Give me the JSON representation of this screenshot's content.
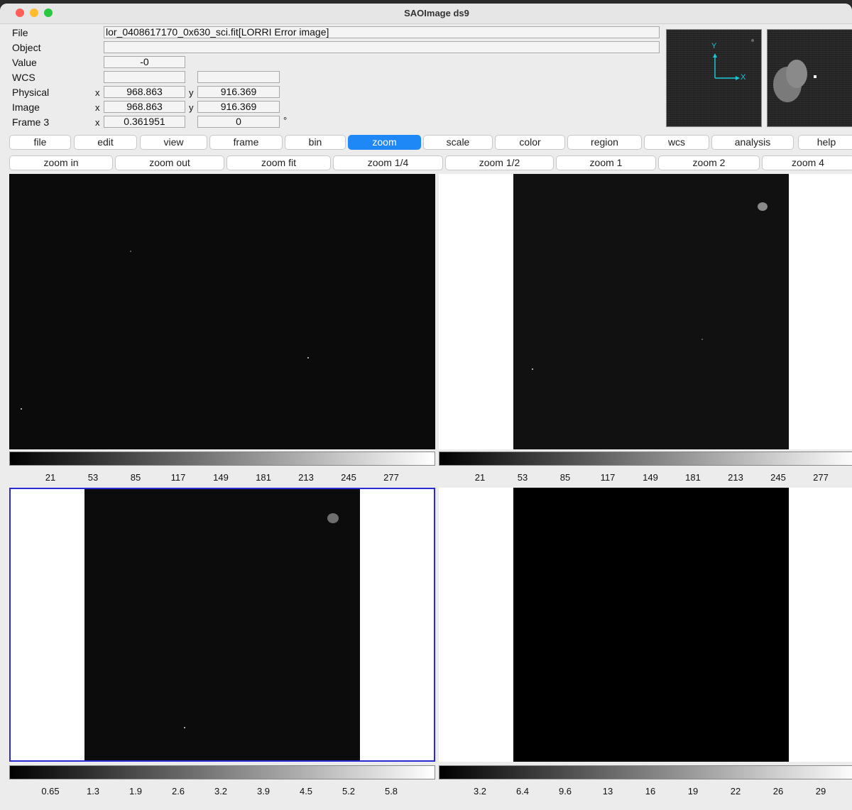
{
  "window": {
    "title": "SAOImage ds9"
  },
  "info": {
    "rows": [
      {
        "label": "File"
      },
      {
        "label": "Object"
      },
      {
        "label": "Value"
      },
      {
        "label": "WCS"
      },
      {
        "label": "Physical",
        "x_label": "x",
        "y_label": "y"
      },
      {
        "label": "Image",
        "x_label": "x",
        "y_label": "y"
      },
      {
        "label": "Frame 3",
        "x_label": "x"
      }
    ],
    "file": "lor_0408617170_0x630_sci.fit[LORRI Error image]",
    "object": "",
    "value": "-0",
    "wcs_a": "",
    "wcs_b": "",
    "physical_x": "968.863",
    "physical_y": "916.369",
    "image_x": "968.863",
    "image_y": "916.369",
    "frame_zoom": "0.361951",
    "frame_angle": "0",
    "degree_symbol": "°"
  },
  "panner": {
    "y_axis": "Y",
    "x_axis": "X",
    "axis_color": "#19c6d8"
  },
  "main_menu": [
    "file",
    "edit",
    "view",
    "frame",
    "bin",
    "zoom",
    "scale",
    "color",
    "region",
    "wcs",
    "analysis",
    "help"
  ],
  "active_menu": "zoom",
  "sub_menu": [
    "zoom in",
    "zoom out",
    "zoom fit",
    "zoom 1/4",
    "zoom 1/2",
    "zoom 1",
    "zoom 2",
    "zoom 4"
  ],
  "colorbars": {
    "top_left": [
      "21",
      "53",
      "85",
      "117",
      "149",
      "181",
      "213",
      "245",
      "277"
    ],
    "top_right": [
      "21",
      "53",
      "85",
      "117",
      "149",
      "181",
      "213",
      "245",
      "277"
    ],
    "bottom_left": [
      "0.65",
      "1.3",
      "1.9",
      "2.6",
      "3.2",
      "3.9",
      "4.5",
      "5.2",
      "5.8"
    ],
    "bottom_right": [
      "3.2",
      "6.4",
      "9.6",
      "13",
      "16",
      "19",
      "22",
      "26",
      "29"
    ]
  },
  "colors": {
    "accent": "#1e88f7",
    "current_frame_border": "#2a2ad8"
  }
}
